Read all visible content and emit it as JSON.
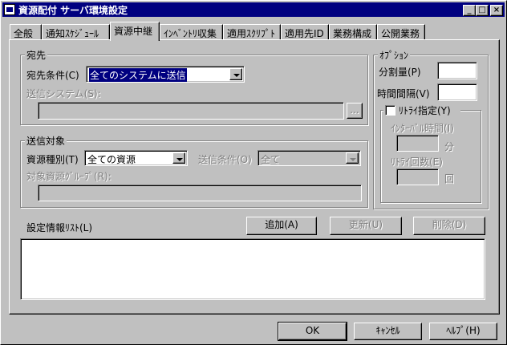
{
  "window": {
    "title": "資源配付 サーバ環境設定",
    "controls": {
      "minimize": "_",
      "maximize": "□",
      "close": "×"
    }
  },
  "tabs": [
    {
      "label": "全般"
    },
    {
      "label": "通知ｽｹｼﾞｭｰﾙ"
    },
    {
      "label": "資源中継"
    },
    {
      "label": "ｲﾝﾍﾞﾝﾄﾘ収集"
    },
    {
      "label": "適用ｽｸﾘﾌﾟﾄ"
    },
    {
      "label": "適用先ID"
    },
    {
      "label": "業務構成"
    },
    {
      "label": "公開業務"
    }
  ],
  "active_tab": "資源中継",
  "destination": {
    "group_label": "宛先",
    "condition_label": "宛先条件(C)",
    "condition_value": "全てのシステムに送信",
    "system_label": "送信システム(S):",
    "system_value": "",
    "browse_label": "..."
  },
  "send_target": {
    "group_label": "送信対象",
    "resource_type_label": "資源種別(T)",
    "resource_type_value": "全ての資源",
    "send_condition_label": "送信条件(O)",
    "send_condition_value": "全て",
    "resource_group_label": "対象資源ｸﾞﾙｰﾌﾟ(R):",
    "resource_group_value": ""
  },
  "options": {
    "group_label": "ｵﾌﾟｼｮﾝ",
    "split_label": "分割量(P)",
    "split_value": "",
    "interval_label": "時間間隔(V)",
    "interval_value": "",
    "retry_label": "ﾘﾄﾗｲ指定(Y)",
    "retry_checked": false,
    "retry_interval_label": "ｲﾝﾀｰﾊﾞﾙ時間(I)",
    "retry_interval_value": "",
    "retry_interval_unit": "分",
    "retry_count_label": "ﾘﾄﾗｲ回数(E)",
    "retry_count_value": "",
    "retry_count_unit": "回"
  },
  "settings_list": {
    "label": "設定情報ﾘｽﾄ(L)",
    "add_label": "追加(A)",
    "update_label": "更新(U)",
    "delete_label": "削除(D)",
    "items": []
  },
  "footer": {
    "ok_label": "OK",
    "cancel_label": "ｷｬﾝｾﾙ",
    "help_label": "ﾍﾙﾌﾟ(H)"
  }
}
